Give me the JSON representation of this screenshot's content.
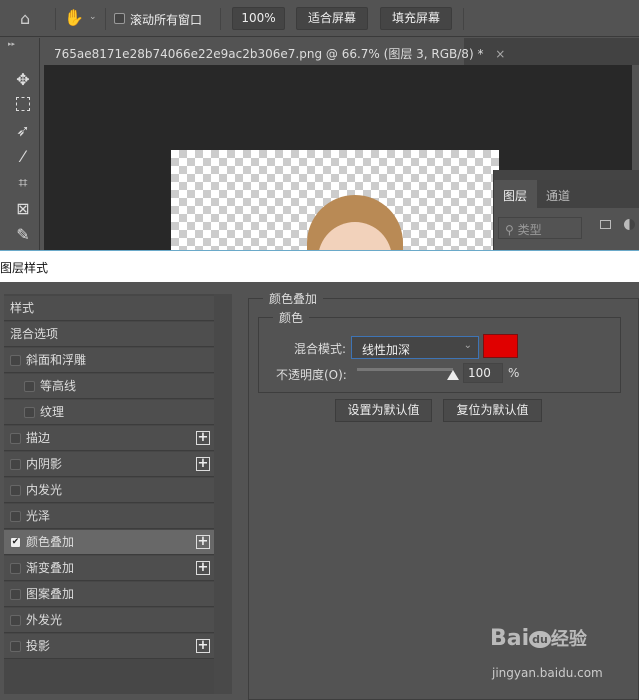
{
  "toolbar": {
    "home_icon": "home-icon",
    "scroll_all_label": "滚动所有窗口",
    "zoom_100": "100%",
    "fit_screen": "适合屏幕",
    "fill_screen": "填充屏幕"
  },
  "document_tab": {
    "title": "765ae8171e28b74066e22e9ac2b306e7.png @ 66.7% (图层 3, RGB/8) *",
    "close": "×"
  },
  "layers_panel": {
    "tabs": [
      "图层",
      "通道"
    ],
    "filter_placeholder": "类型"
  },
  "dialog": {
    "title": "图层样式",
    "styles_list": [
      {
        "label": "样式",
        "checkbox": false,
        "plus": false
      },
      {
        "label": "混合选项",
        "checkbox": false,
        "plus": false
      },
      {
        "label": "斜面和浮雕",
        "checkbox": true,
        "checked": false,
        "plus": false
      },
      {
        "label": "等高线",
        "checkbox": true,
        "checked": false,
        "plus": false,
        "indent": true
      },
      {
        "label": "纹理",
        "checkbox": true,
        "checked": false,
        "plus": false,
        "indent": true
      },
      {
        "label": "描边",
        "checkbox": true,
        "checked": false,
        "plus": true
      },
      {
        "label": "内阴影",
        "checkbox": true,
        "checked": false,
        "plus": true
      },
      {
        "label": "内发光",
        "checkbox": true,
        "checked": false,
        "plus": false
      },
      {
        "label": "光泽",
        "checkbox": true,
        "checked": false,
        "plus": false
      },
      {
        "label": "颜色叠加",
        "checkbox": true,
        "checked": true,
        "plus": true,
        "selected": true
      },
      {
        "label": "渐变叠加",
        "checkbox": true,
        "checked": false,
        "plus": true
      },
      {
        "label": "图案叠加",
        "checkbox": true,
        "checked": false,
        "plus": false
      },
      {
        "label": "外发光",
        "checkbox": true,
        "checked": false,
        "plus": false
      },
      {
        "label": "投影",
        "checkbox": true,
        "checked": false,
        "plus": true
      }
    ],
    "section_title": "颜色叠加",
    "group_title": "颜色",
    "blend_mode_label": "混合模式:",
    "blend_mode_value": "线性加深",
    "overlay_color": "#e00000",
    "opacity_label": "不透明度(O):",
    "opacity_value": "100",
    "opacity_unit": "%",
    "opacity_fraction": 1.0,
    "set_default": "设置为默认值",
    "reset_default": "复位为默认值"
  },
  "watermark": {
    "brand": "Bai 经验",
    "url": "jingyan.baidu.com"
  }
}
